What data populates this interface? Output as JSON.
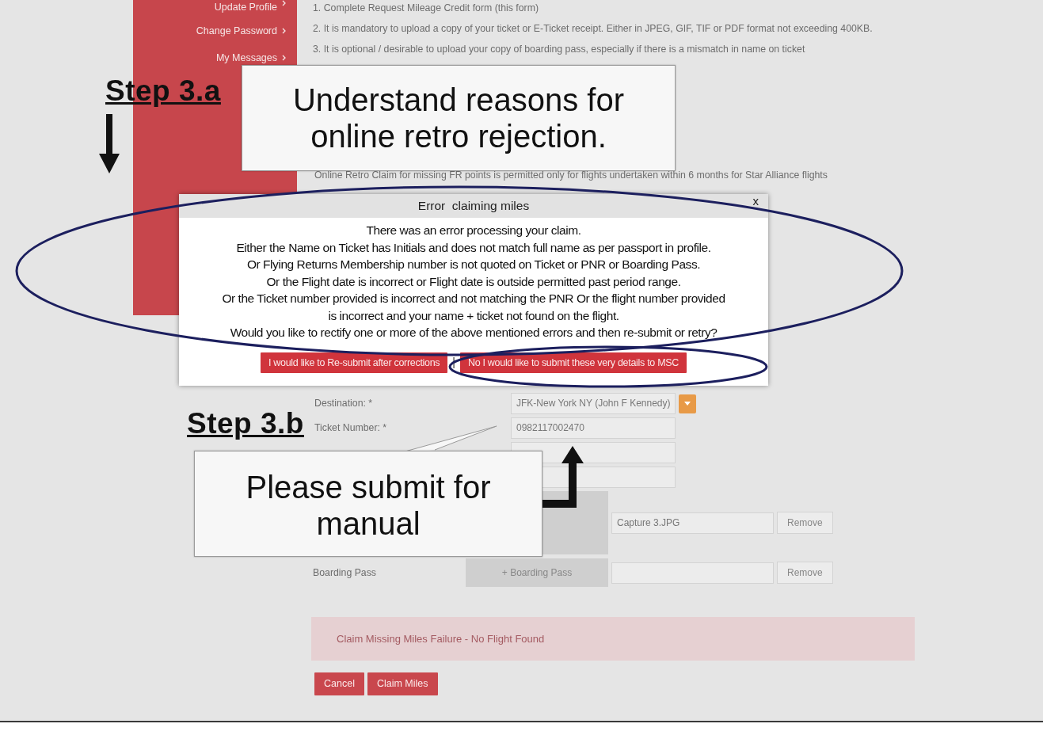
{
  "sidebar": {
    "items": [
      {
        "label": "Update Profile"
      },
      {
        "label": "Change Password"
      },
      {
        "label": "My Messages"
      }
    ]
  },
  "instructions": [
    "1. Complete Request Mileage Credit form (this form)",
    "2. It is mandatory to upload a copy of your ticket or E-Ticket receipt. Either in JPEG, GIF, TIF or PDF format not exceeding 400KB.",
    "3. It is optional / desirable to upload your copy of boarding pass, especially if there is a mismatch in name on ticket"
  ],
  "retro_note": "Online Retro Claim for missing FR points is permitted only for flights undertaken within 6 months for Star Alliance flights",
  "form": {
    "fields": [
      {
        "kind": "select",
        "label": "Destination: *",
        "value": "JFK-New York NY (John F Kennedy)"
      },
      {
        "kind": "text",
        "label": "Ticket Number: *",
        "value": "0982117002470"
      },
      {
        "kind": "text"
      },
      {
        "kind": "text"
      },
      {
        "kind": "upload",
        "value": "Capture 3.JPG",
        "action": "Remove"
      },
      {
        "kind": "upload",
        "label": "Boarding Pass",
        "button": "+ Boarding Pass",
        "action": "Remove"
      }
    ]
  },
  "alert": "Claim Missing Miles Failure - No Flight Found",
  "buttons": [
    "Cancel",
    "Claim Miles"
  ],
  "dialog": {
    "title": "Error  claiming miles",
    "close": "x",
    "message_lines": [
      "There was an error processing your claim.",
      "Either the Name on Ticket has Initials and does not match full name as per passport in profile.",
      "Or Flying Returns Membership number is not quoted on Ticket or PNR or Boarding Pass.",
      "Or the Flight date is incorrect or Flight date is outside permitted past period range.",
      "Or the Ticket number provided is incorrect and not matching the PNR Or the flight number provided",
      "is incorrect and your name + ticket not found on the flight.",
      "Would you like to rectify one or more of the above mentioned errors and then re-submit or retry?"
    ],
    "buttons": [
      "I would like to Re-submit after corrections",
      "No I would like to submit these very details to MSC"
    ],
    "separator": "|"
  },
  "annotations": {
    "step_a": "Step 3.a",
    "callout_a": "Understand reasons for online retro rejection.",
    "step_b": "Step 3.b",
    "callout_b": "Please submit for manual"
  }
}
